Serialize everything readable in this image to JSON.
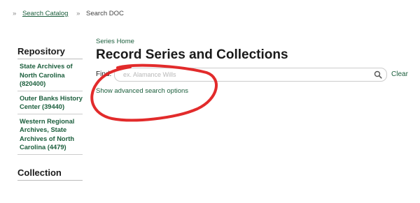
{
  "breadcrumb": {
    "separator": "»",
    "link_label": "Search Catalog",
    "current_label": "Search DOC"
  },
  "sidebar": {
    "repository_heading": "Repository",
    "items": [
      {
        "label": "State Archives of North Carolina (820400)"
      },
      {
        "label": "Outer Banks History Center (39440)"
      },
      {
        "label": "Western Regional Archives, State Archives of North Carolina (4479)"
      }
    ],
    "collection_heading": "Collection"
  },
  "main": {
    "series_home_label": "Series Home",
    "title": "Record Series and Collections",
    "find_label": "Find:",
    "search_placeholder": "ex. Alamance Wills",
    "search_value": "",
    "clear_label": "Clear",
    "advanced_label": "Show advanced search options"
  },
  "icons": {
    "search": "search-icon"
  },
  "colors": {
    "link": "#1b5e3c",
    "annotation": "#e02020"
  }
}
